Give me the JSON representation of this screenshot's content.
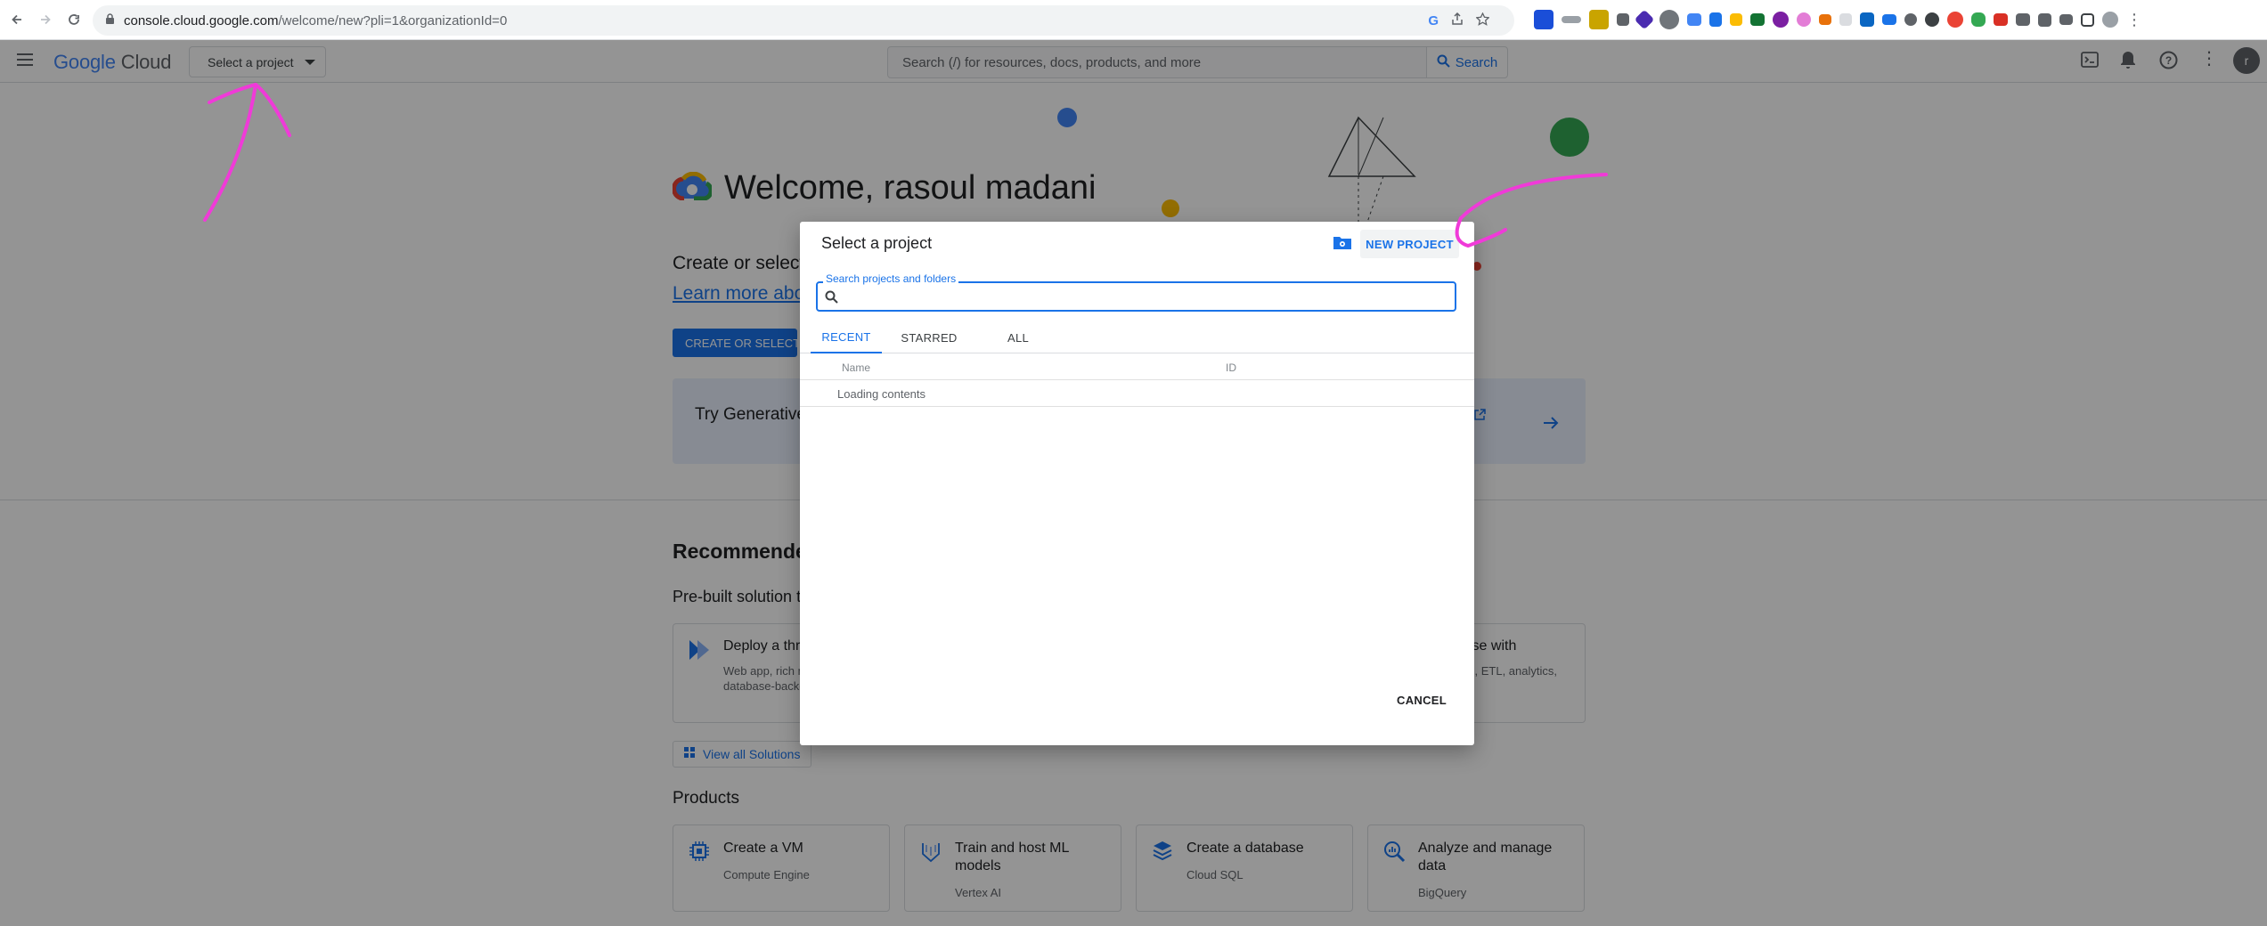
{
  "browser": {
    "url_host": "console.cloud.google.com",
    "url_path": "/welcome/new?pli=1&organizationId=0"
  },
  "header": {
    "logo_google": "Google",
    "logo_cloud": "Cloud",
    "project_selector": "Select a project",
    "search_placeholder": "Search (/) for resources, docs, products, and more",
    "search_button": "Search",
    "avatar_initial": "r"
  },
  "welcome": {
    "title": "Welcome, rasoul madani",
    "create_text": "Create or select",
    "learn_link": "Learn more abo",
    "create_button": "CREATE OR SELECT A",
    "try_card": "Try Generative"
  },
  "recommended": {
    "title": "Recommende",
    "prebuilt": "Pre-built solution t",
    "cards": [
      {
        "title": "Deploy a thre",
        "desc_line1": "Web app, rich m",
        "desc_line2": "database-backe"
      },
      {
        "title": "ise with",
        "desc_line1": "s, ETL, analytics,",
        "desc_line2": ""
      }
    ],
    "view_all": "View all Solutions"
  },
  "products": {
    "title": "Products",
    "items": [
      {
        "title": "Create a VM",
        "sub": "Compute Engine",
        "icon": "chip-icon"
      },
      {
        "title": "Train and host ML models",
        "sub": "Vertex AI",
        "icon": "vertex-icon"
      },
      {
        "title": "Create a database",
        "sub": "Cloud SQL",
        "icon": "database-icon"
      },
      {
        "title": "Analyze and manage data",
        "sub": "BigQuery",
        "icon": "bigquery-icon"
      }
    ]
  },
  "dialog": {
    "title": "Select a project",
    "new_project": "NEW PROJECT",
    "search_label": "Search projects and folders",
    "search_value": "",
    "tabs": [
      "RECENT",
      "STARRED",
      "ALL"
    ],
    "active_tab": "RECENT",
    "col_name": "Name",
    "col_id": "ID",
    "loading": "Loading contents",
    "cancel": "CANCEL"
  },
  "colors": {
    "accent": "#1a73e8",
    "annotation": "#f03ad8"
  }
}
